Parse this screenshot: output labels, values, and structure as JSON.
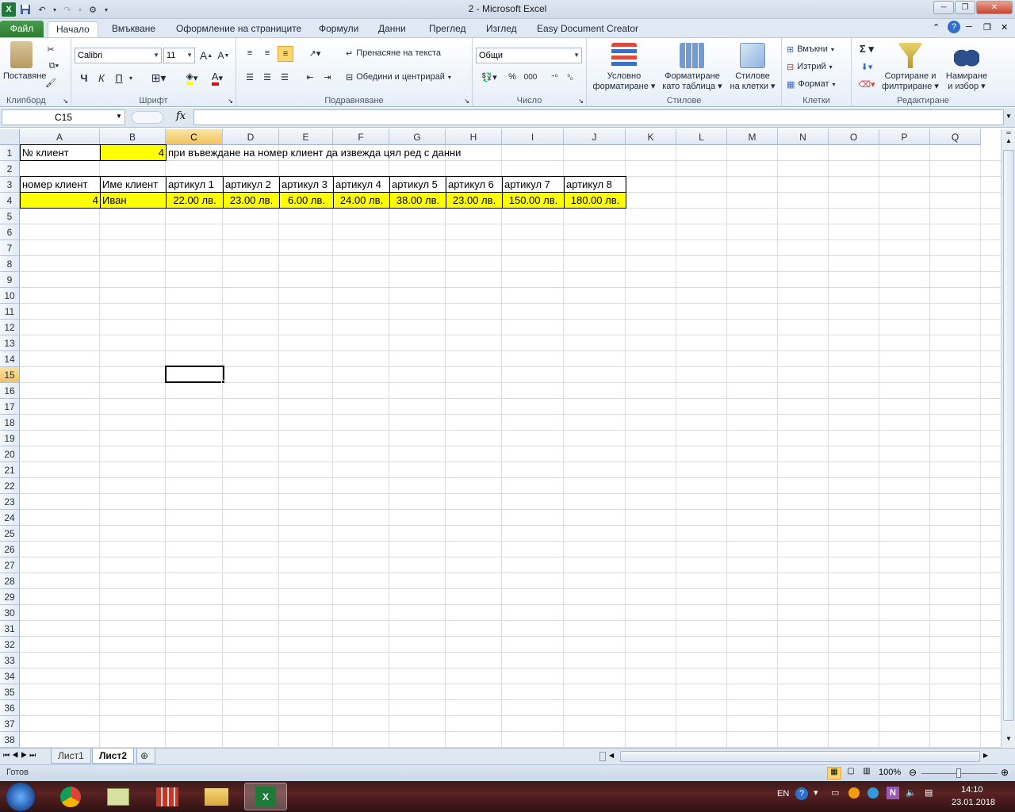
{
  "window": {
    "title": "2  -  Microsoft Excel"
  },
  "tabs": [
    {
      "label": "Файл"
    },
    {
      "label": "Начало"
    },
    {
      "label": "Вмъкване"
    },
    {
      "label": "Оформление на страниците"
    },
    {
      "label": "Формули"
    },
    {
      "label": "Данни"
    },
    {
      "label": "Преглед"
    },
    {
      "label": "Изглед"
    },
    {
      "label": "Easy Document Creator"
    }
  ],
  "ribbon": {
    "clipboard": {
      "paste": "Поставяне",
      "label": "Клипборд"
    },
    "font": {
      "name": "Calibri",
      "size": "11",
      "bold": "Ч",
      "italic": "К",
      "underline": "П",
      "label": "Шрифт"
    },
    "alignment": {
      "wrap": "Пренасяне на текста",
      "merge": "Обедини и центрирай",
      "label": "Подравняване"
    },
    "number": {
      "format": "Общи",
      "label": "Число",
      "percent": "%",
      "thousands": "000"
    },
    "styles": {
      "conditional_1": "Условно",
      "conditional_2": "форматиране",
      "table_1": "Форматиране",
      "table_2": "като таблица",
      "cell_1": "Стилове",
      "cell_2": "на клетки",
      "label": "Стилове"
    },
    "cells": {
      "insert": "Вмъкни",
      "delete": "Изтрий",
      "format": "Формат",
      "label": "Клетки"
    },
    "editing": {
      "sort_1": "Сортиране и",
      "sort_2": "филтриране",
      "find_1": "Намиране",
      "find_2": "и избор",
      "label": "Редактиране"
    }
  },
  "formula_bar": {
    "name_box": "C15",
    "fx": "fx",
    "content": ""
  },
  "columns": [
    "A",
    "B",
    "C",
    "D",
    "E",
    "F",
    "G",
    "H",
    "I",
    "J",
    "K",
    "L",
    "M",
    "N",
    "O",
    "P",
    "Q"
  ],
  "rows": [
    "1",
    "2",
    "3",
    "4",
    "5",
    "6",
    "7",
    "8",
    "9",
    "10",
    "11",
    "12",
    "13",
    "14",
    "15",
    "16",
    "17",
    "18",
    "19",
    "20",
    "21",
    "22",
    "23",
    "24",
    "25",
    "26",
    "27",
    "28",
    "29",
    "30",
    "31",
    "32",
    "33",
    "34",
    "35",
    "36",
    "37",
    "38"
  ],
  "cells": {
    "A1": "№ клиент",
    "B1": "4",
    "C1": "при въвеждане на номер клиент да извежда цял ред с данни",
    "A3": "номер клиент",
    "B3": "Име клиент",
    "C3": "артикул 1",
    "D3": "артикул 2",
    "E3": "артикул 3",
    "F3": "артикул 4",
    "G3": "артикул 5",
    "H3": "артикул 6",
    "I3": "артикул 7",
    "J3": "артикул 8",
    "A4": "4",
    "B4": "Иван",
    "C4": "22.00 лв.",
    "D4": "23.00 лв.",
    "E4": "6.00 лв.",
    "F4": "24.00 лв.",
    "G4": "38.00 лв.",
    "H4": "23.00 лв.",
    "I4": "150.00 лв.",
    "J4": "180.00 лв."
  },
  "sheets": [
    {
      "label": "Лист1"
    },
    {
      "label": "Лист2"
    }
  ],
  "status": {
    "ready": "Готов",
    "zoom": "100%"
  },
  "taskbar": {
    "lang": "EN",
    "time": "14:10",
    "date": "23.01.2018"
  },
  "colors": {
    "highlight": "#ffff00",
    "file_tab": "#2c7d32",
    "selected_header": "#f2c35e"
  }
}
